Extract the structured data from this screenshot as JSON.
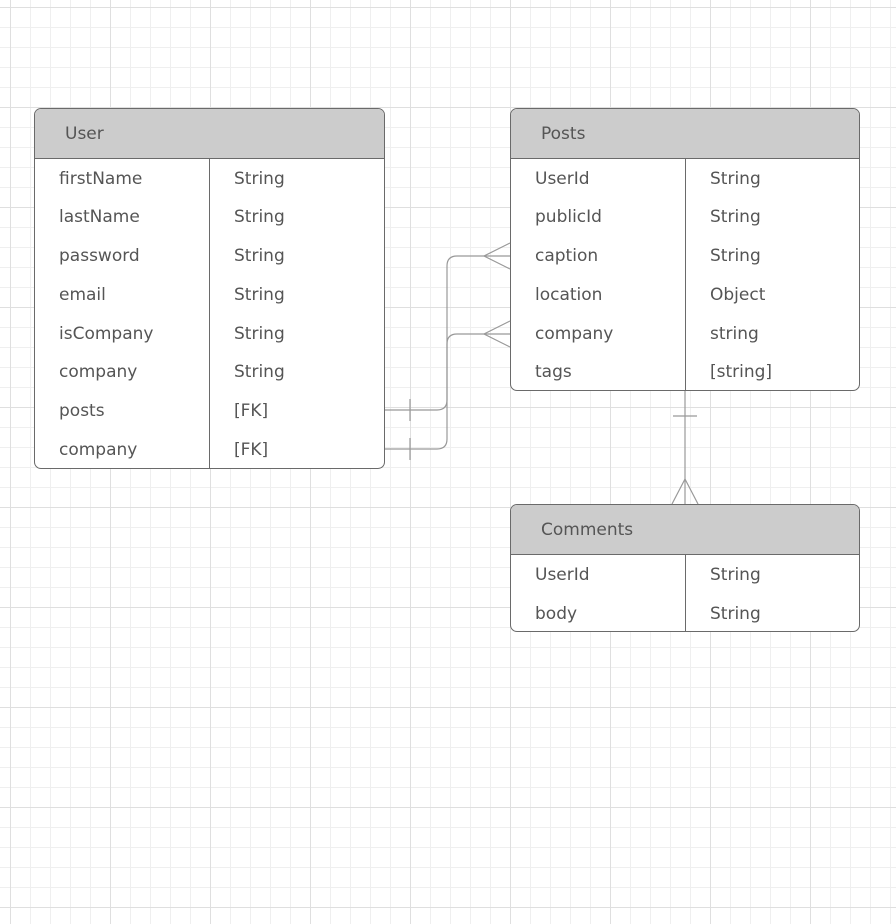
{
  "entities": {
    "user": {
      "title": "User",
      "fields": [
        {
          "name": "firstName",
          "type": "String"
        },
        {
          "name": "lastName",
          "type": "String"
        },
        {
          "name": "password",
          "type": "String"
        },
        {
          "name": "email",
          "type": "String"
        },
        {
          "name": "isCompany",
          "type": "String"
        },
        {
          "name": "company",
          "type": "String"
        },
        {
          "name": "posts",
          "type": "[FK]"
        },
        {
          "name": "company",
          "type": "[FK]"
        }
      ]
    },
    "posts": {
      "title": "Posts",
      "fields": [
        {
          "name": "UserId",
          "type": "String"
        },
        {
          "name": "publicId",
          "type": "String"
        },
        {
          "name": "caption",
          "type": "String"
        },
        {
          "name": "location",
          "type": "Object"
        },
        {
          "name": "company",
          "type": "string"
        },
        {
          "name": "tags",
          "type": "[string]"
        }
      ]
    },
    "comments": {
      "title": "Comments",
      "fields": [
        {
          "name": "UserId",
          "type": "String"
        },
        {
          "name": "body",
          "type": "String"
        }
      ]
    }
  },
  "relationships": [
    {
      "from": "User.posts",
      "to": "Posts.caption",
      "from_cardinality": "one",
      "to_cardinality": "many"
    },
    {
      "from": "User.company",
      "to": "Posts.company",
      "from_cardinality": "one",
      "to_cardinality": "many"
    },
    {
      "from": "Posts",
      "to": "Comments",
      "from_cardinality": "one",
      "to_cardinality": "many"
    }
  ],
  "colors": {
    "header_fill": "#cccccc",
    "border": "#6a6a6a",
    "connector": "#999999",
    "text": "#555555"
  }
}
